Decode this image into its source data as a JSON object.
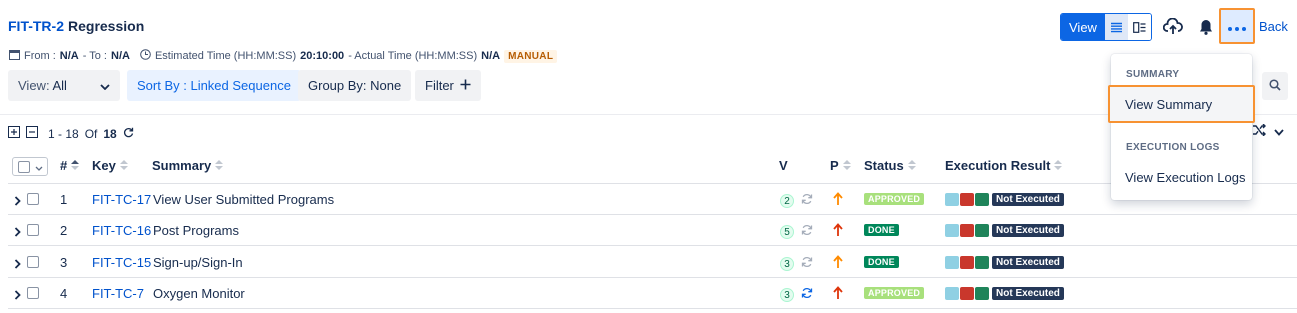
{
  "header": {
    "test_key": "FIT-TR-2",
    "test_name": "Regression",
    "from_label": "From :",
    "from_value": "N/A",
    "to_sep": "- To :",
    "to_value": "N/A",
    "estimated_label": "Estimated Time (HH:MM:SS)",
    "estimated_value": "20:10:00",
    "actual_label": "- Actual Time (HH:MM:SS)",
    "actual_value": "N/A",
    "type_badge": "MANUAL",
    "view_label": "View",
    "back_label": "Back"
  },
  "toolbar": {
    "view_prefix": "View:",
    "view_value": "All",
    "sort_label": "Sort By : Linked Sequence",
    "group_label": "Group By: None",
    "filter_label": "Filter"
  },
  "pager": {
    "range": "1 - 18",
    "of": "Of",
    "total": "18"
  },
  "table": {
    "columns": {
      "num": "#",
      "key": "Key",
      "summary": "Summary",
      "v": "V",
      "p": "P",
      "status": "Status",
      "result": "Execution Result"
    },
    "rows": [
      {
        "num": "1",
        "key": "FIT-TC-17",
        "summary": "View User Submitted Programs",
        "version": "2",
        "priority": "medium",
        "status": "APPROVED",
        "result": "Not Executed"
      },
      {
        "num": "2",
        "key": "FIT-TC-16",
        "summary": "Post Programs",
        "version": "5",
        "priority": "high",
        "status": "DONE",
        "result": "Not Executed"
      },
      {
        "num": "3",
        "key": "FIT-TC-15",
        "summary": "Sign-up/Sign-In",
        "version": "3",
        "priority": "medium",
        "status": "DONE",
        "result": "Not Executed"
      },
      {
        "num": "4",
        "key": "FIT-TC-7",
        "summary": "Oxygen Monitor",
        "version": "3",
        "priority": "high",
        "status": "APPROVED",
        "result": "Not Executed"
      }
    ]
  },
  "menu": {
    "summary_heading": "SUMMARY",
    "view_summary": "View Summary",
    "logs_heading": "EXECUTION LOGS",
    "view_logs": "View Execution Logs"
  },
  "colors": {
    "accent": "#0c66e4",
    "highlight": "#f79232",
    "approved": "#a8e07c",
    "done": "#00875a",
    "priority_medium": "#ff8b00",
    "priority_high": "#de350b",
    "sq_blue": "#8fd0e3",
    "sq_red": "#c9372c",
    "sq_green": "#1f845a"
  }
}
